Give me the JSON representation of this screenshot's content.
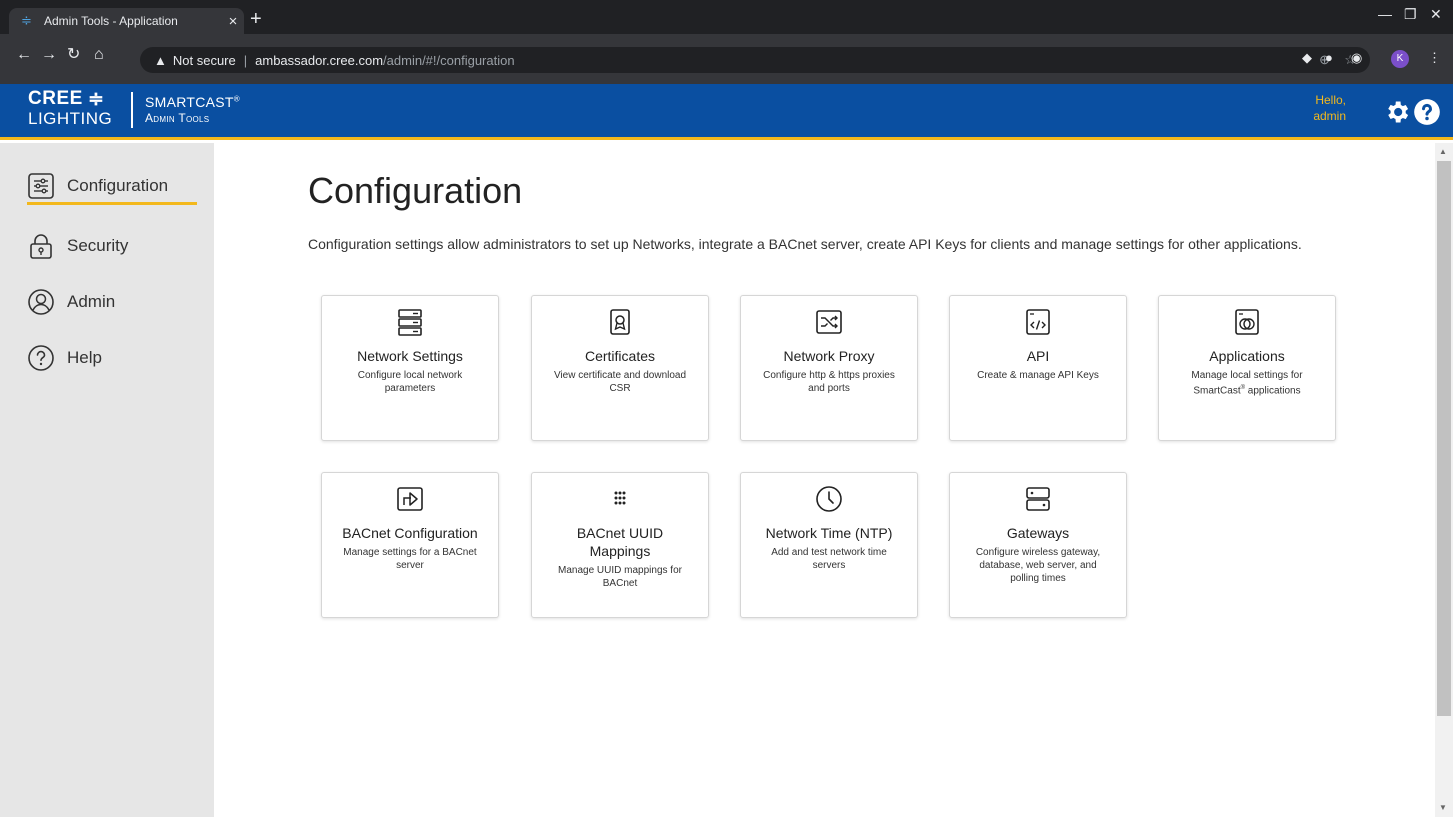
{
  "browser": {
    "tab_title": "Admin Tools - Application",
    "tab_close": "×",
    "new_tab": "+",
    "security_label": "Not secure",
    "url_host": "ambassador.cree.com",
    "url_path": "/admin/#!/configuration",
    "profile_initial": "K",
    "icons": [
      "back-icon",
      "forward-icon",
      "reload-icon",
      "home-icon",
      "warning-icon",
      "zoom-icon",
      "star-icon",
      "extension-icon",
      "menu-icon"
    ]
  },
  "header": {
    "logo_top": "CREE",
    "logo_bottom": "LIGHTING",
    "product_name": "SMARTCAST",
    "product_sub": "Admin Tools",
    "greeting": "Hello,",
    "username": "admin",
    "accent": "#f3b81c",
    "brand": "#0a4fa1"
  },
  "sidebar": {
    "items": [
      {
        "label": "Configuration",
        "icon": "sliders-icon",
        "active": true
      },
      {
        "label": "Security",
        "icon": "lock-icon"
      },
      {
        "label": "Admin",
        "icon": "user-icon"
      },
      {
        "label": "Help",
        "icon": "help-icon"
      }
    ]
  },
  "main": {
    "title": "Configuration",
    "description": "Configuration settings allow administrators to set up Networks, integrate a BACnet server, create API Keys for clients and manage settings for other applications.",
    "cards": [
      {
        "title": "Network Settings",
        "desc": "Configure local network parameters",
        "icon": "server-stack-icon"
      },
      {
        "title": "Certificates",
        "desc": "View certificate and download CSR",
        "icon": "certificate-icon"
      },
      {
        "title": "Network Proxy",
        "desc": "Configure http & https proxies and ports",
        "icon": "shuffle-icon"
      },
      {
        "title": "API",
        "desc": "Create & manage API Keys",
        "icon": "code-window-icon"
      },
      {
        "title": "Applications",
        "desc_a": "Manage local settings for SmartCast",
        "desc_sup": "®",
        "desc_b": " applications",
        "icon": "app-window-icon"
      },
      {
        "title": "BACnet Configuration",
        "desc": "Manage settings for a BACnet server",
        "icon": "export-arrow-icon"
      },
      {
        "title": "BACnet UUID Mappings",
        "desc": "Manage UUID mappings for BACnet",
        "icon": "dot-grid-icon"
      },
      {
        "title": "Network Time (NTP)",
        "desc": "Add and test network time servers",
        "icon": "clock-icon"
      },
      {
        "title": "Gateways",
        "desc": "Configure wireless gateway, database, web server, and polling times",
        "icon": "gateway-icon"
      }
    ]
  }
}
